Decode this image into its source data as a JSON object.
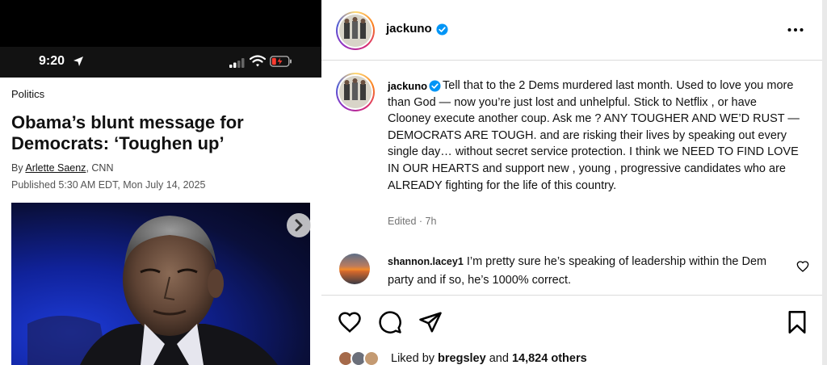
{
  "phone": {
    "status": {
      "time": "9:20"
    },
    "article": {
      "section": "Politics",
      "headline": "Obama’s blunt message for Democrats: ‘Toughen up’",
      "byline_prefix": "By",
      "author": "Arlette Saenz",
      "byline_suffix": ", CNN",
      "published": "Published 5:30 AM EDT, Mon July 14, 2025"
    }
  },
  "post": {
    "username": "jackuno",
    "caption": {
      "username": "jackuno",
      "text": "Tell that to the 2 Dems murdered last month. Used to love you more than God — now you’re just lost and unhelpful. Stick to Netflix , or have Clooney execute another coup. Ask me ? ANY TOUGHER AND WE’D RUST — DEMOCRATS ARE TOUGH. and are risking their lives by speaking out every single day… without secret service protection. I think we NEED TO FIND LOVE IN OUR HEARTS and support new , young , progressive candidates who are ALREADY fighting for the life of this country."
    },
    "edited": "Edited · 7h",
    "comment": {
      "username": "shannon.lacey1",
      "text": " I’m pretty sure he’s speaking of leadership within the Dem party and if so, he’s 1000% correct."
    },
    "likes": {
      "prefix": "Liked by ",
      "user": "bregsley",
      "middle": " and ",
      "count": "14,824 others"
    }
  },
  "colors": {
    "verified": "#0095f6",
    "divider": "#dbdbdb",
    "muted": "#737373"
  },
  "icons": [
    "location-arrow-icon",
    "signal-icon",
    "wifi-icon",
    "battery-icon",
    "chevron-right-icon",
    "verified-icon",
    "more-icon",
    "heart-icon",
    "comment-icon",
    "share-icon",
    "bookmark-icon"
  ]
}
